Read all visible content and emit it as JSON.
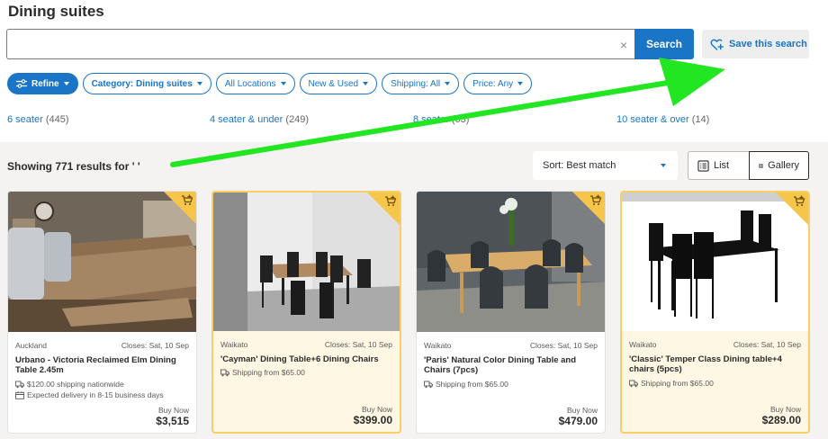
{
  "page": {
    "title": "Dining suites"
  },
  "search": {
    "value": "",
    "clear": "×",
    "button": "Search"
  },
  "save_search": {
    "label": "Save this search"
  },
  "filters": [
    {
      "label": "Refine",
      "style": "primary"
    },
    {
      "label": "Category: Dining suites",
      "style": "bold"
    },
    {
      "label": "All Locations",
      "style": "normal"
    },
    {
      "label": "New & Used",
      "style": "normal"
    },
    {
      "label": "Shipping: All",
      "style": "normal"
    },
    {
      "label": "Price: Any",
      "style": "normal"
    }
  ],
  "subcategories": [
    {
      "label": "6 seater",
      "count": "(445)"
    },
    {
      "label": "4 seater & under",
      "count": "(249)"
    },
    {
      "label": "8 seater",
      "count": "(63)"
    },
    {
      "label": "10 seater & over",
      "count": "(14)"
    }
  ],
  "results": {
    "count_text": "Showing 771 results for ' '"
  },
  "sort": {
    "label": "Sort: Best match"
  },
  "view": {
    "list": "List",
    "gallery": "Gallery"
  },
  "listings": [
    {
      "location": "Auckland",
      "closes": "Closes: Sat, 10 Sep",
      "title": "Urbano - Victoria Reclaimed Elm Dining Table 2.45m",
      "lines": [
        "$120.00 shipping nationwide",
        "Expected delivery in 8-15 business days"
      ],
      "buy_label": "Buy Now",
      "price": "$3,515",
      "featured": false
    },
    {
      "location": "Waikato",
      "closes": "Closes: Sat, 10 Sep",
      "title": "'Cayman' Dining Table+6 Dining Chairs",
      "lines": [
        "Shipping from $65.00"
      ],
      "buy_label": "Buy Now",
      "price": "$399.00",
      "featured": true
    },
    {
      "location": "Waikato",
      "closes": "Closes: Sat, 10 Sep",
      "title": "'Paris' Natural Color Dining Table and Chairs (7pcs)",
      "lines": [
        "Shipping from $65.00"
      ],
      "buy_label": "Buy Now",
      "price": "$479.00",
      "featured": false
    },
    {
      "location": "Waikato",
      "closes": "Closes: Sat, 10 Sep",
      "title": "'Classic' Temper Class Dining table+4 chairs (5pcs)",
      "lines": [
        "Shipping from $65.00"
      ],
      "buy_label": "Buy Now",
      "price": "$289.00",
      "featured": true
    }
  ],
  "colors": {
    "accent": "#1a75c7",
    "featured_bg": "#fdf7e3",
    "featured_border": "#f7cf66",
    "annotation_arrow": "#22e622"
  }
}
